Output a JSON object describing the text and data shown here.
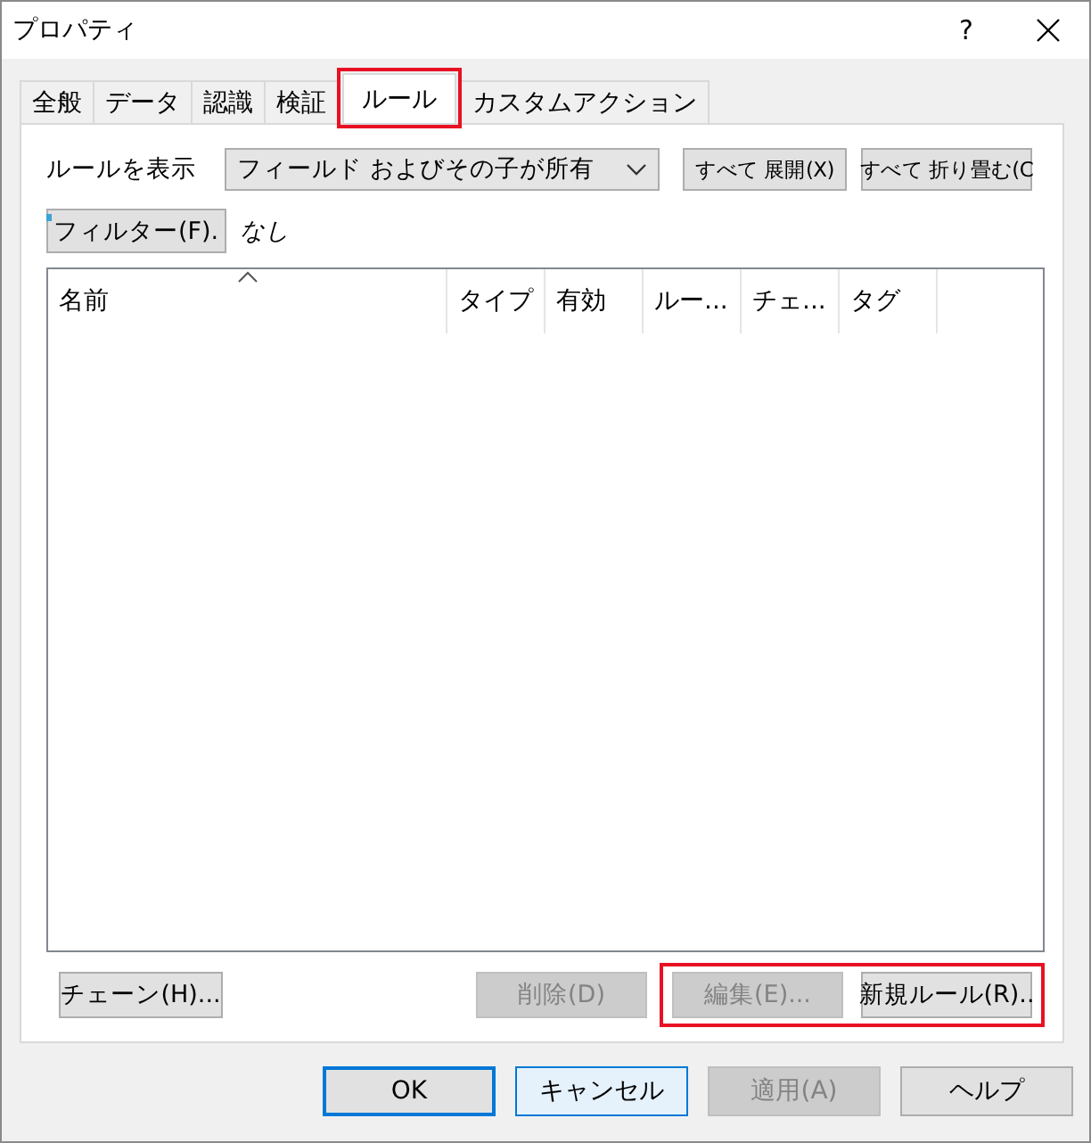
{
  "window": {
    "title": "プロパティ",
    "help": "?"
  },
  "tabs": [
    {
      "label": "全般",
      "selected": false,
      "highlighted": false
    },
    {
      "label": "データ",
      "selected": false,
      "highlighted": false
    },
    {
      "label": "認識",
      "selected": false,
      "highlighted": false
    },
    {
      "label": "検証",
      "selected": false,
      "highlighted": false
    },
    {
      "label": "ルール",
      "selected": true,
      "highlighted": true
    },
    {
      "label": "カスタムアクション",
      "selected": false,
      "highlighted": false
    }
  ],
  "show_rules": {
    "label": "ルールを表示",
    "value": "フィールド およびその子が所有"
  },
  "expand_buttons": [
    {
      "label": "すべて 展開(X)"
    },
    {
      "label": "すべて 折り畳む(C"
    }
  ],
  "filter": {
    "button": "フィルター(F).",
    "value": "なし"
  },
  "list": {
    "columns": [
      {
        "label": "名前",
        "sorted": true
      },
      {
        "label": "タイプ",
        "sorted": false
      },
      {
        "label": "有効",
        "sorted": false
      },
      {
        "label": "ルー...",
        "sorted": false
      },
      {
        "label": "チェ...",
        "sorted": false
      },
      {
        "label": "タグ",
        "sorted": false
      }
    ]
  },
  "panel_buttons": [
    {
      "label": "チェーン(H)...",
      "disabled": false,
      "highlighted": false
    },
    {
      "label": "削除(D)",
      "disabled": true,
      "highlighted": false
    },
    {
      "label": "編集(E)...",
      "disabled": true,
      "highlighted": true
    },
    {
      "label": "新規ルール(R)..",
      "disabled": false,
      "highlighted": true
    }
  ],
  "dialog_buttons": [
    {
      "label": "OK",
      "disabled": false,
      "default": true,
      "focused": false
    },
    {
      "label": "キャンセル",
      "disabled": false,
      "default": false,
      "focused": true
    },
    {
      "label": "適用(A)",
      "disabled": true,
      "default": false,
      "focused": false
    },
    {
      "label": "ヘルプ",
      "disabled": false,
      "default": false,
      "focused": false
    }
  ]
}
